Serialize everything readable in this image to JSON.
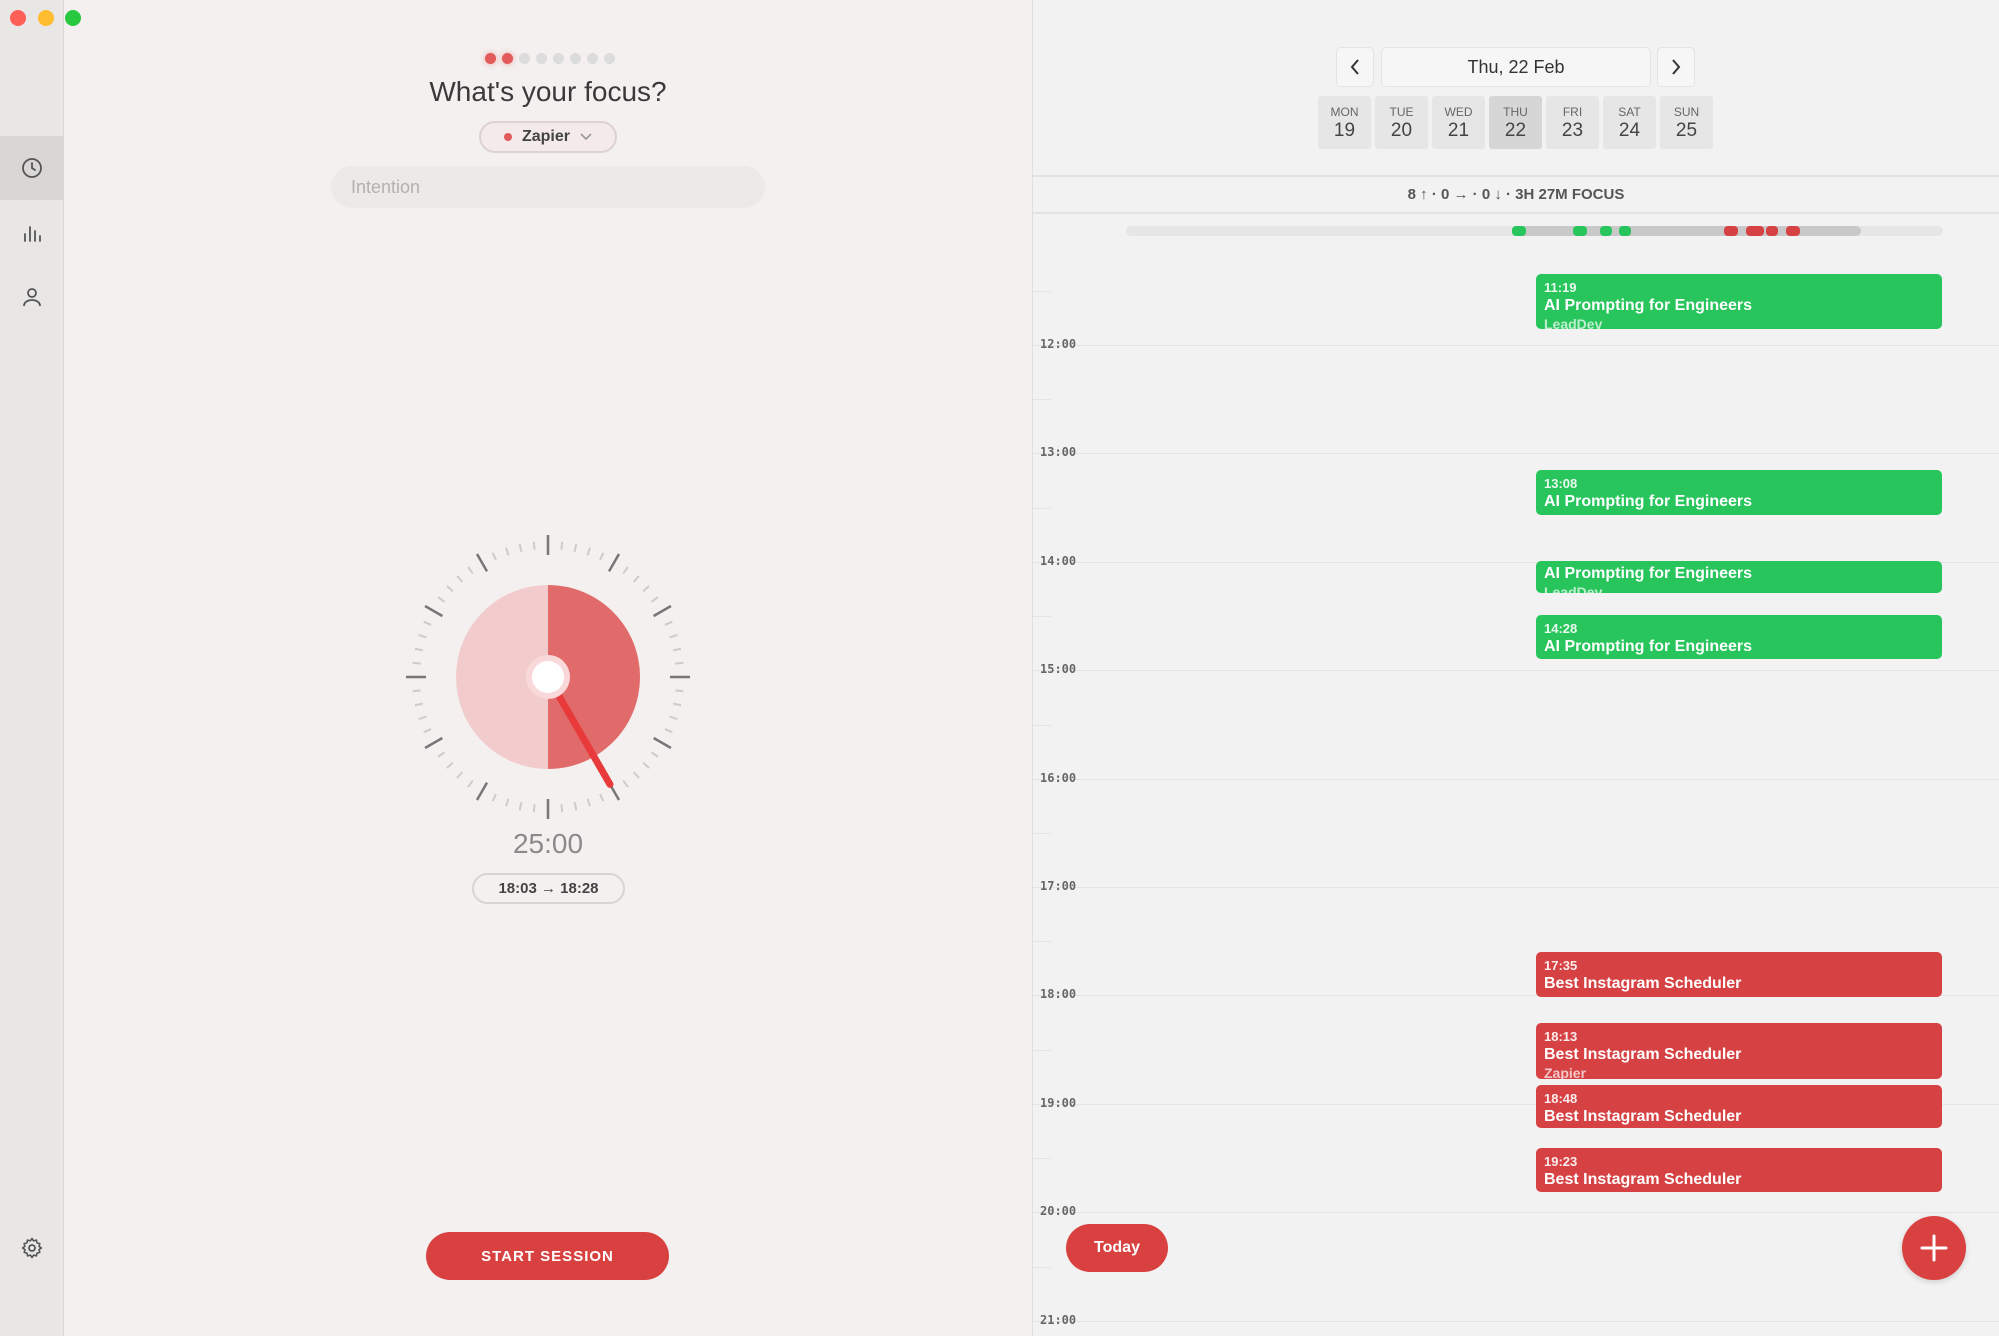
{
  "window": {
    "traffic_lights": [
      "#fe5f57",
      "#febc2e",
      "#28c840"
    ]
  },
  "sidebar": {
    "items": [
      {
        "icon": "clock-icon",
        "active": true
      },
      {
        "icon": "bar-chart-icon"
      },
      {
        "icon": "person-icon"
      }
    ],
    "settings_icon": "gear-icon"
  },
  "focus": {
    "step_total": 8,
    "step_done": 2,
    "title": "What's your focus?",
    "project": {
      "label": "Zapier",
      "color": "#e25a5a"
    },
    "intention": {
      "placeholder": "Intention",
      "value": ""
    },
    "timer": {
      "remaining": "25:00",
      "range": "18:03 → 18:28",
      "minutes": 25
    },
    "start_label": "START SESSION"
  },
  "calendar": {
    "date_label": "Thu, 22 Feb",
    "days": [
      {
        "name": "MON",
        "num": "19"
      },
      {
        "name": "TUE",
        "num": "20"
      },
      {
        "name": "WED",
        "num": "21"
      },
      {
        "name": "THU",
        "num": "22",
        "selected": true
      },
      {
        "name": "FRI",
        "num": "23"
      },
      {
        "name": "SAT",
        "num": "24"
      },
      {
        "name": "SUN",
        "num": "25"
      }
    ],
    "summary": "8 ↑ · 0 → · 0 ↓ · 3H 27M FOCUS",
    "hours": [
      "12:00",
      "13:00",
      "14:00",
      "15:00",
      "16:00",
      "17:00",
      "18:00",
      "19:00",
      "20:00",
      "21:00"
    ],
    "events": [
      {
        "time": "11:19",
        "name": "AI Prompting for Engineers",
        "sub": "LeadDev",
        "color": "green"
      },
      {
        "time": "13:08",
        "name": "AI Prompting for Engineers",
        "sub": "",
        "color": "green"
      },
      {
        "time": "",
        "name": "AI Prompting for Engineers",
        "sub": "LeadDev",
        "color": "green"
      },
      {
        "time": "14:28",
        "name": "AI Prompting for Engineers",
        "sub": "",
        "color": "green"
      },
      {
        "time": "17:35",
        "name": "Best Instagram Scheduler",
        "sub": "",
        "color": "red"
      },
      {
        "time": "18:13",
        "name": "Best Instagram Scheduler",
        "sub": "Zapier",
        "color": "red"
      },
      {
        "time": "18:48",
        "name": "Best Instagram Scheduler",
        "sub": "",
        "color": "red"
      },
      {
        "time": "19:23",
        "name": "Best Instagram Scheduler",
        "sub": "",
        "color": "red"
      }
    ],
    "today_label": "Today",
    "colors": {
      "green": "#27c55c",
      "red": "#d64244"
    }
  }
}
